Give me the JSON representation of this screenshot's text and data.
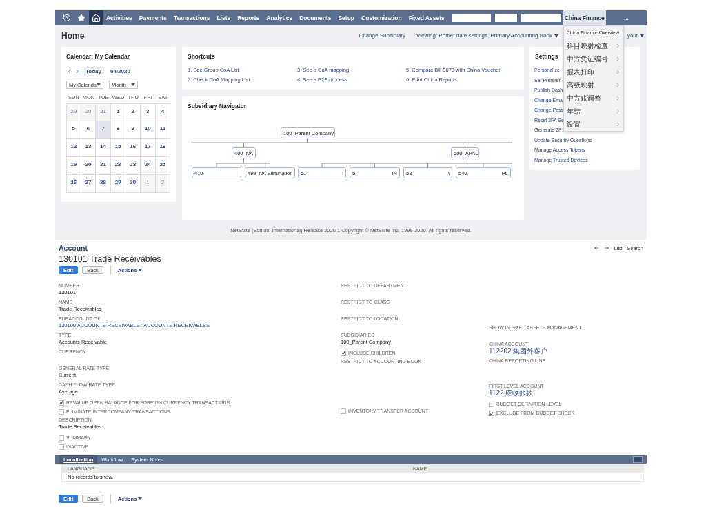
{
  "nav": {
    "items": [
      {
        "kind": "link",
        "label": "Activities",
        "selected": false
      },
      {
        "kind": "link",
        "label": "Payments",
        "selected": false
      },
      {
        "kind": "link",
        "label": "Transactions",
        "selected": false
      },
      {
        "kind": "link",
        "label": "Lists",
        "selected": false
      },
      {
        "kind": "link",
        "label": "Reports",
        "selected": false
      },
      {
        "kind": "link",
        "label": "Analytics",
        "selected": false
      },
      {
        "kind": "link",
        "label": "Documents",
        "selected": false
      },
      {
        "kind": "link",
        "label": "Setup",
        "selected": false
      },
      {
        "kind": "link",
        "label": "Customization",
        "selected": false
      },
      {
        "kind": "link",
        "label": "Fixed Assets",
        "selected": false
      },
      {
        "kind": "redacted"
      },
      {
        "kind": "redacted"
      },
      {
        "kind": "redacted"
      },
      {
        "kind": "link",
        "label": "China Finance",
        "selected": true
      },
      {
        "kind": "more",
        "label": "..."
      }
    ],
    "menu": [
      {
        "label": "China Finance Overview",
        "submenu": false
      },
      {
        "label": "科目映射检查",
        "submenu": true
      },
      {
        "label": "中方凭证编号",
        "submenu": true
      },
      {
        "label": "报表打印",
        "submenu": true
      },
      {
        "label": "高级映射",
        "submenu": true
      },
      {
        "label": "中方账调整",
        "submenu": true
      },
      {
        "label": "年结",
        "submenu": true
      },
      {
        "label": "设置",
        "submenu": true
      }
    ]
  },
  "header": {
    "title": "Home",
    "change_subsidiary": "Change Subsidiary",
    "viewing": "Viewing: Portlet date settings, Primary Accounting Book",
    "layout": "yout"
  },
  "calendar": {
    "title": "Calendar: My Calendar",
    "today": "Today",
    "month": "04/2020",
    "calendar_select": "My Calenda",
    "view_select": "Month",
    "weekdays": [
      "SUN",
      "MON",
      "TUE",
      "WED",
      "THU",
      "FRI",
      "SAT"
    ],
    "weeks": [
      [
        {
          "label": "29",
          "outside": true,
          "selected": false
        },
        {
          "label": "30",
          "outside": true,
          "selected": false
        },
        {
          "label": "31",
          "outside": true,
          "selected": false
        },
        {
          "label": "1",
          "outside": false,
          "selected": false
        },
        {
          "label": "2",
          "outside": false,
          "selected": false
        },
        {
          "label": "3",
          "outside": false,
          "selected": false
        },
        {
          "label": "4",
          "outside": false,
          "selected": false
        }
      ],
      [
        {
          "label": "5",
          "outside": false,
          "selected": false
        },
        {
          "label": "6",
          "outside": false,
          "selected": false
        },
        {
          "label": "7",
          "outside": false,
          "selected": true
        },
        {
          "label": "8",
          "outside": false,
          "selected": false
        },
        {
          "label": "9",
          "outside": false,
          "selected": false
        },
        {
          "label": "10",
          "outside": false,
          "selected": false
        },
        {
          "label": "11",
          "outside": false,
          "selected": false
        }
      ],
      [
        {
          "label": "12",
          "outside": false,
          "selected": false
        },
        {
          "label": "13",
          "outside": false,
          "selected": false
        },
        {
          "label": "14",
          "outside": false,
          "selected": false
        },
        {
          "label": "15",
          "outside": false,
          "selected": false
        },
        {
          "label": "16",
          "outside": false,
          "selected": false
        },
        {
          "label": "17",
          "outside": false,
          "selected": false
        },
        {
          "label": "18",
          "outside": false,
          "selected": false
        }
      ],
      [
        {
          "label": "19",
          "outside": false,
          "selected": false
        },
        {
          "label": "20",
          "outside": false,
          "selected": false
        },
        {
          "label": "21",
          "outside": false,
          "selected": false
        },
        {
          "label": "22",
          "outside": false,
          "selected": false
        },
        {
          "label": "23",
          "outside": false,
          "selected": false
        },
        {
          "label": "24",
          "outside": false,
          "selected": false
        },
        {
          "label": "25",
          "outside": false,
          "selected": false
        }
      ],
      [
        {
          "label": "26",
          "outside": false,
          "selected": false
        },
        {
          "label": "27",
          "outside": false,
          "selected": false
        },
        {
          "label": "28",
          "outside": false,
          "selected": false
        },
        {
          "label": "29",
          "outside": false,
          "selected": false
        },
        {
          "label": "30",
          "outside": false,
          "selected": false
        },
        {
          "label": "1",
          "outside": true,
          "selected": false
        },
        {
          "label": "2",
          "outside": true,
          "selected": false
        }
      ]
    ]
  },
  "shortcuts": {
    "title": "Shortcuts",
    "links": [
      "1. See Group CoA List",
      "2. Check CoA Mapping List",
      "3. See a CoA mapping",
      "4. See a P2P process",
      "5. Compare Bill 9678 with China Voucher",
      "6. Print China Reports"
    ]
  },
  "navigator": {
    "title": "Subsidiary Navigator",
    "root": {
      "label": "100_Parent Company",
      "children": [
        {
          "label": "400_NA",
          "children": [
            {
              "label": "410"
            },
            {
              "label": "499_NA Elimination"
            }
          ]
        },
        {
          "label": "500_APAC",
          "children": [
            {
              "label": "51",
              "tail": "i"
            },
            {
              "label": "5",
              "tail": "IN"
            },
            {
              "label": "53",
              "tail": "\\"
            },
            {
              "label": "540",
              "tail": "PL"
            }
          ]
        }
      ]
    }
  },
  "settings": {
    "title": "Settings",
    "links": [
      "Personalize",
      "Set Preferen",
      "Publish Dash",
      "Change Ema",
      "Change Pass",
      "Reset 2FA Se",
      "Generate 2F",
      "Update Security Questions",
      "Manage Access Tokens",
      "Manage Trusted Devices"
    ]
  },
  "footer": "NetSuite (Edition: International) Release 2020.1 Copyright © NetSuite Inc. 1999-2020. All rights reserved.",
  "record": {
    "type": "Account",
    "title": "130101 Trade Receivables",
    "list": "List",
    "search": "Search",
    "buttons": {
      "edit": "Edit",
      "back": "Back",
      "actions": "Actions"
    },
    "bottom_buttons": {
      "edit": "Edit",
      "back": "Back",
      "actions": "Actions"
    },
    "columns": [
      [
        {
          "kind": "field",
          "label": "NUMBER",
          "value": "130101",
          "link": false
        },
        {
          "kind": "field",
          "label": "NAME",
          "value": "Trade Receivables",
          "link": false
        },
        {
          "kind": "field",
          "label": "SUBACCOUNT OF",
          "value": "130100 ACCOUNTS RECEIVABLE : ACCOUNTS RECEIVABLES",
          "link": true
        },
        {
          "kind": "field",
          "label": "TYPE",
          "value": "Accounts Receivable",
          "link": false
        },
        {
          "kind": "field",
          "label": "CURRENCY"
        },
        {
          "kind": "field",
          "label": "GENERAL RATE TYPE",
          "value": "Current",
          "link": false
        },
        {
          "kind": "field",
          "label": "CASH FLOW RATE TYPE",
          "value": "Average",
          "link": false
        },
        {
          "kind": "checkbox",
          "label": "REVALUE OPEN BALANCE FOR FOREIGN CURRENCY TRANSACTIONS",
          "checked": true
        },
        {
          "kind": "checkbox",
          "label": "ELIMINATE INTERCOMPANY TRANSACTIONS",
          "checked": false
        },
        {
          "kind": "field",
          "label": "DESCRIPTION",
          "value": "Trade Receivables",
          "link": false
        },
        {
          "kind": "checkbox",
          "label": "SUMMARY",
          "checked": false
        },
        {
          "kind": "checkbox",
          "label": "INACTIVE",
          "checked": false
        }
      ],
      [
        {
          "kind": "field",
          "label": "RESTRICT TO DEPARTMENT"
        },
        {
          "kind": "field",
          "label": "RESTRICT TO CLASS"
        },
        {
          "kind": "field",
          "label": "RESTRICT TO LOCATION"
        },
        {
          "kind": "field",
          "label": "SUBSIDIARIES",
          "value": "100_Parent Company",
          "link": false
        },
        {
          "kind": "checkbox",
          "label": "INCLUDE CHILDREN",
          "checked": true
        },
        {
          "kind": "field",
          "label": "RESTRICT TO ACCOUNTING BOOK"
        },
        {
          "kind": "checkbox",
          "label": "INVENTORY TRANSFER ACCOUNT",
          "checked": false
        }
      ],
      [
        {
          "kind": "field",
          "label": "SHOW IN FIXED ASSETS MANAGEMENT"
        },
        {
          "kind": "field",
          "label": "CHINA ACCOUNT",
          "value": "112202 集团外客户",
          "link": true
        },
        {
          "kind": "field",
          "label": "CHINA REPORTING LINE"
        },
        {
          "kind": "field",
          "label": "FIRST LEVEL ACCOUNT",
          "value": "1122 应收账款",
          "link": true
        },
        {
          "kind": "checkbox",
          "label": "BUDGET DEFINITION LEVEL",
          "checked": false
        },
        {
          "kind": "checkbox",
          "label": "EXCLUDE FROM BUDGET CHECK",
          "checked": true
        }
      ]
    ],
    "tabs": [
      {
        "label": "Localization",
        "selected": true
      },
      {
        "label": "Workflow",
        "selected": false
      },
      {
        "label": "System Notes",
        "selected": false
      }
    ],
    "table": {
      "columns": [
        "LANGUAGE",
        "NAME"
      ],
      "empty": "No records to show."
    }
  }
}
